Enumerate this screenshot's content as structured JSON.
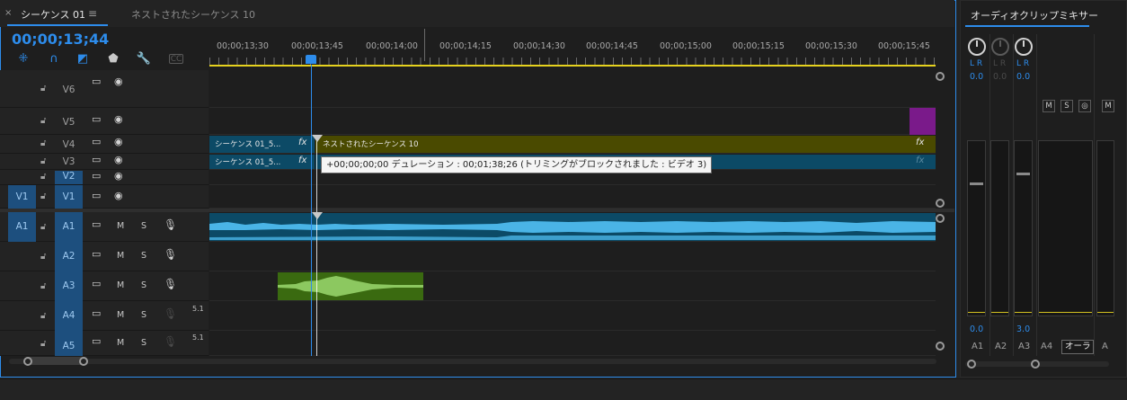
{
  "timeline": {
    "tab_close": "×",
    "tab_title": "シーケンス 01",
    "tab_menu": "≡",
    "tab_title2": "ネストされたシーケンス 10",
    "timecode": "00;00;13;44",
    "ruler_labels": [
      "00;00;13;30",
      "00;00;13;45",
      "00;00;14;00",
      "00;00;14;15",
      "00;00;14;30",
      "00;00;14;45",
      "00;00;15;00",
      "00;00;15;15",
      "00;00;15;30",
      "00;00;15;45"
    ],
    "video_tracks": [
      {
        "name": "V6",
        "targeted": false
      },
      {
        "name": "V5",
        "targeted": false
      },
      {
        "name": "V4",
        "targeted": false
      },
      {
        "name": "V3",
        "targeted": false
      },
      {
        "name": "V2",
        "targeted": true
      },
      {
        "name": "V1",
        "targeted": true,
        "source": "V1"
      }
    ],
    "audio_tracks": [
      {
        "name": "A1",
        "targeted": true,
        "source": "A1",
        "mute": "M",
        "solo": "S"
      },
      {
        "name": "A2",
        "targeted": true,
        "mute": "M",
        "solo": "S"
      },
      {
        "name": "A3",
        "targeted": true,
        "mute": "M",
        "solo": "S"
      },
      {
        "name": "A4",
        "targeted": true,
        "mute": "M",
        "solo": "S",
        "channels": "5.1"
      },
      {
        "name": "A5",
        "targeted": true,
        "mute": "M",
        "solo": "S",
        "channels": "5.1"
      }
    ],
    "clips": {
      "v4_left": "シーケンス 01_5...",
      "v4_main": "ネストされたシーケンス 10",
      "v3_left": "シーケンス 01_5...",
      "fx": "fx"
    },
    "tooltip": "+00;00;00;00 デュレーション : 00;01;38;26 (トリミングがブロックされました : ビデオ 3)"
  },
  "colors": {
    "accent": "#2d8ceb",
    "clip_olive": "#4a4a00",
    "clip_teal": "#0c4a66",
    "clip_purple": "#7a1a8a",
    "clip_green": "#3a6a10",
    "waveform": "#4ab4e6"
  },
  "mixer": {
    "title": "オーディオクリップミキサー",
    "channels": [
      {
        "name": "A1",
        "pan_lr": "L R",
        "pan": "0.0",
        "volume": "0.0",
        "active": true
      },
      {
        "name": "A2",
        "pan_lr": "L R",
        "pan": "0.0",
        "volume": "",
        "active": false
      },
      {
        "name": "A3",
        "pan_lr": "L R",
        "pan": "0.0",
        "volume": "3.0",
        "active": true
      },
      {
        "name": "A4",
        "active": false
      },
      {
        "name": "A",
        "active": false
      }
    ],
    "master_label": "オーラ",
    "ms_labels": [
      "M",
      "S",
      "◎",
      "M"
    ]
  }
}
